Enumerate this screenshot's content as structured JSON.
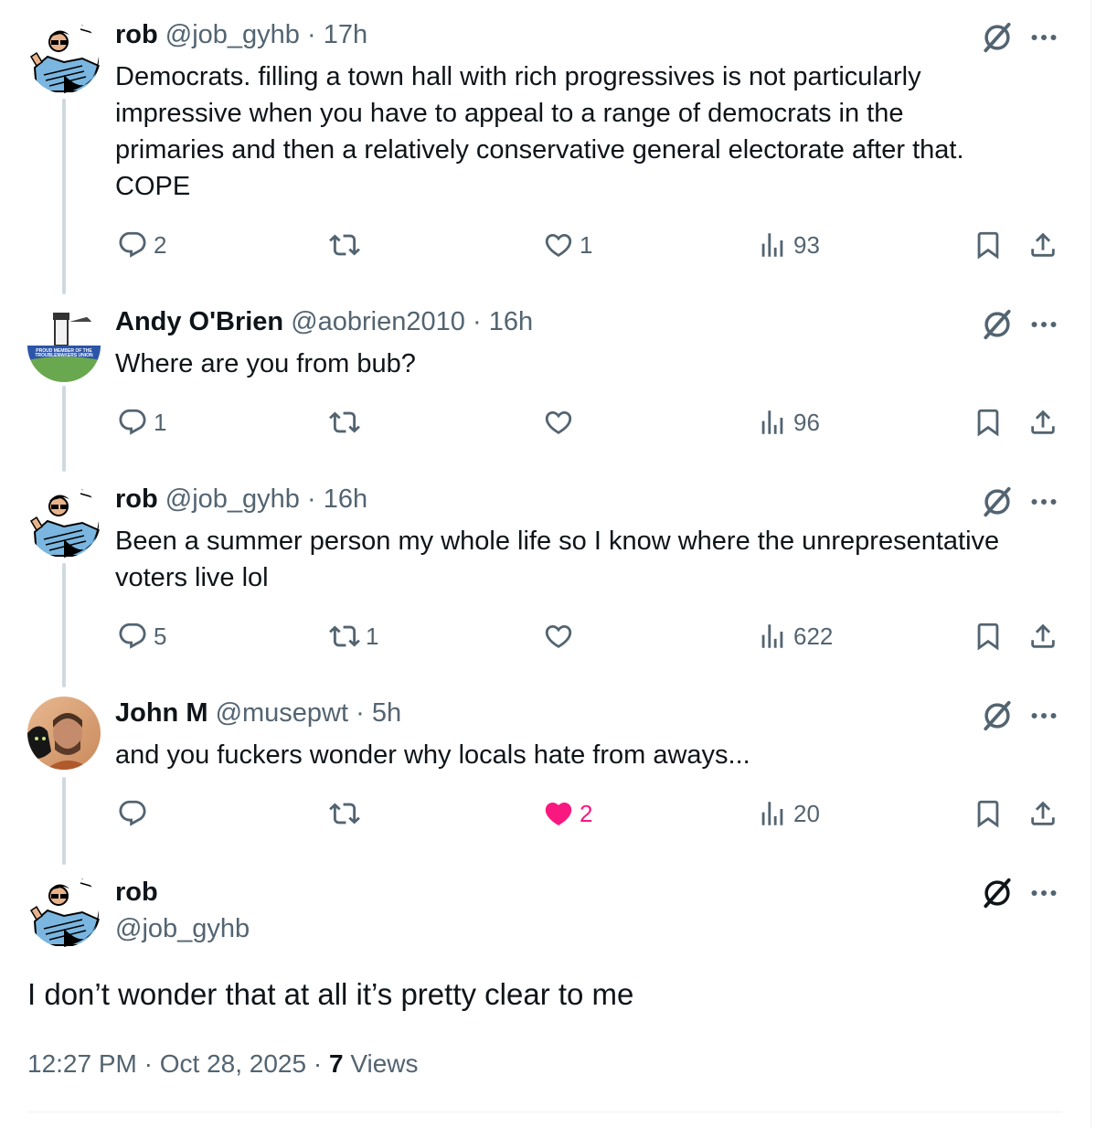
{
  "replies": [
    {
      "name": "rob",
      "handle": "@job_gyhb",
      "separator": "·",
      "time": "17h",
      "text_lines": [
        "Democrats. filling a town hall with rich progressives is not particularly",
        "impressive when you have to appeal to a range of democrats in the",
        "primaries and then a relatively conservative general electorate after that.",
        "COPE"
      ],
      "replies_count": "2",
      "reposts_count": "",
      "likes_count": "1",
      "views_count": "93",
      "liked": false,
      "avatar_icon": "avatar-cartoon-man-icon"
    },
    {
      "name": "Andy O'Brien",
      "handle": "@aobrien2010",
      "separator": "·",
      "time": "16h",
      "text_lines": [
        "Where are you from bub?"
      ],
      "replies_count": "1",
      "reposts_count": "",
      "likes_count": "",
      "views_count": "96",
      "liked": false,
      "avatar_icon": "avatar-lighthouse-icon",
      "avatar_text": [
        "PROUD MEMBER OF THE",
        "TROUBLEMAKERS UNION"
      ]
    },
    {
      "name": "rob",
      "handle": "@job_gyhb",
      "separator": "·",
      "time": "16h",
      "text_lines": [
        "Been a summer person my whole life so I know where the unrepresentative",
        "voters live lol"
      ],
      "replies_count": "5",
      "reposts_count": "1",
      "likes_count": "",
      "views_count": "622",
      "liked": false,
      "avatar_icon": "avatar-cartoon-man-icon"
    },
    {
      "name": "John M",
      "handle": "@musepwt",
      "separator": "·",
      "time": "5h",
      "text_lines": [
        "and you fuckers wonder why locals hate from aways..."
      ],
      "replies_count": "",
      "reposts_count": "",
      "likes_count": "2",
      "views_count": "20",
      "liked": true,
      "avatar_icon": "avatar-photo-icon"
    }
  ],
  "main_tweet": {
    "name": "rob",
    "handle": "@job_gyhb",
    "text": "I don’t wonder that at all it’s pretty clear to me",
    "time": "12:27 PM",
    "separator": "·",
    "date": "Oct 28, 2025",
    "views_count": "7",
    "views_label": "Views"
  },
  "colors": {
    "text_primary": "#0f1419",
    "text_secondary": "#536471",
    "like_active": "#f91880",
    "thread_line": "#cfd9de"
  }
}
